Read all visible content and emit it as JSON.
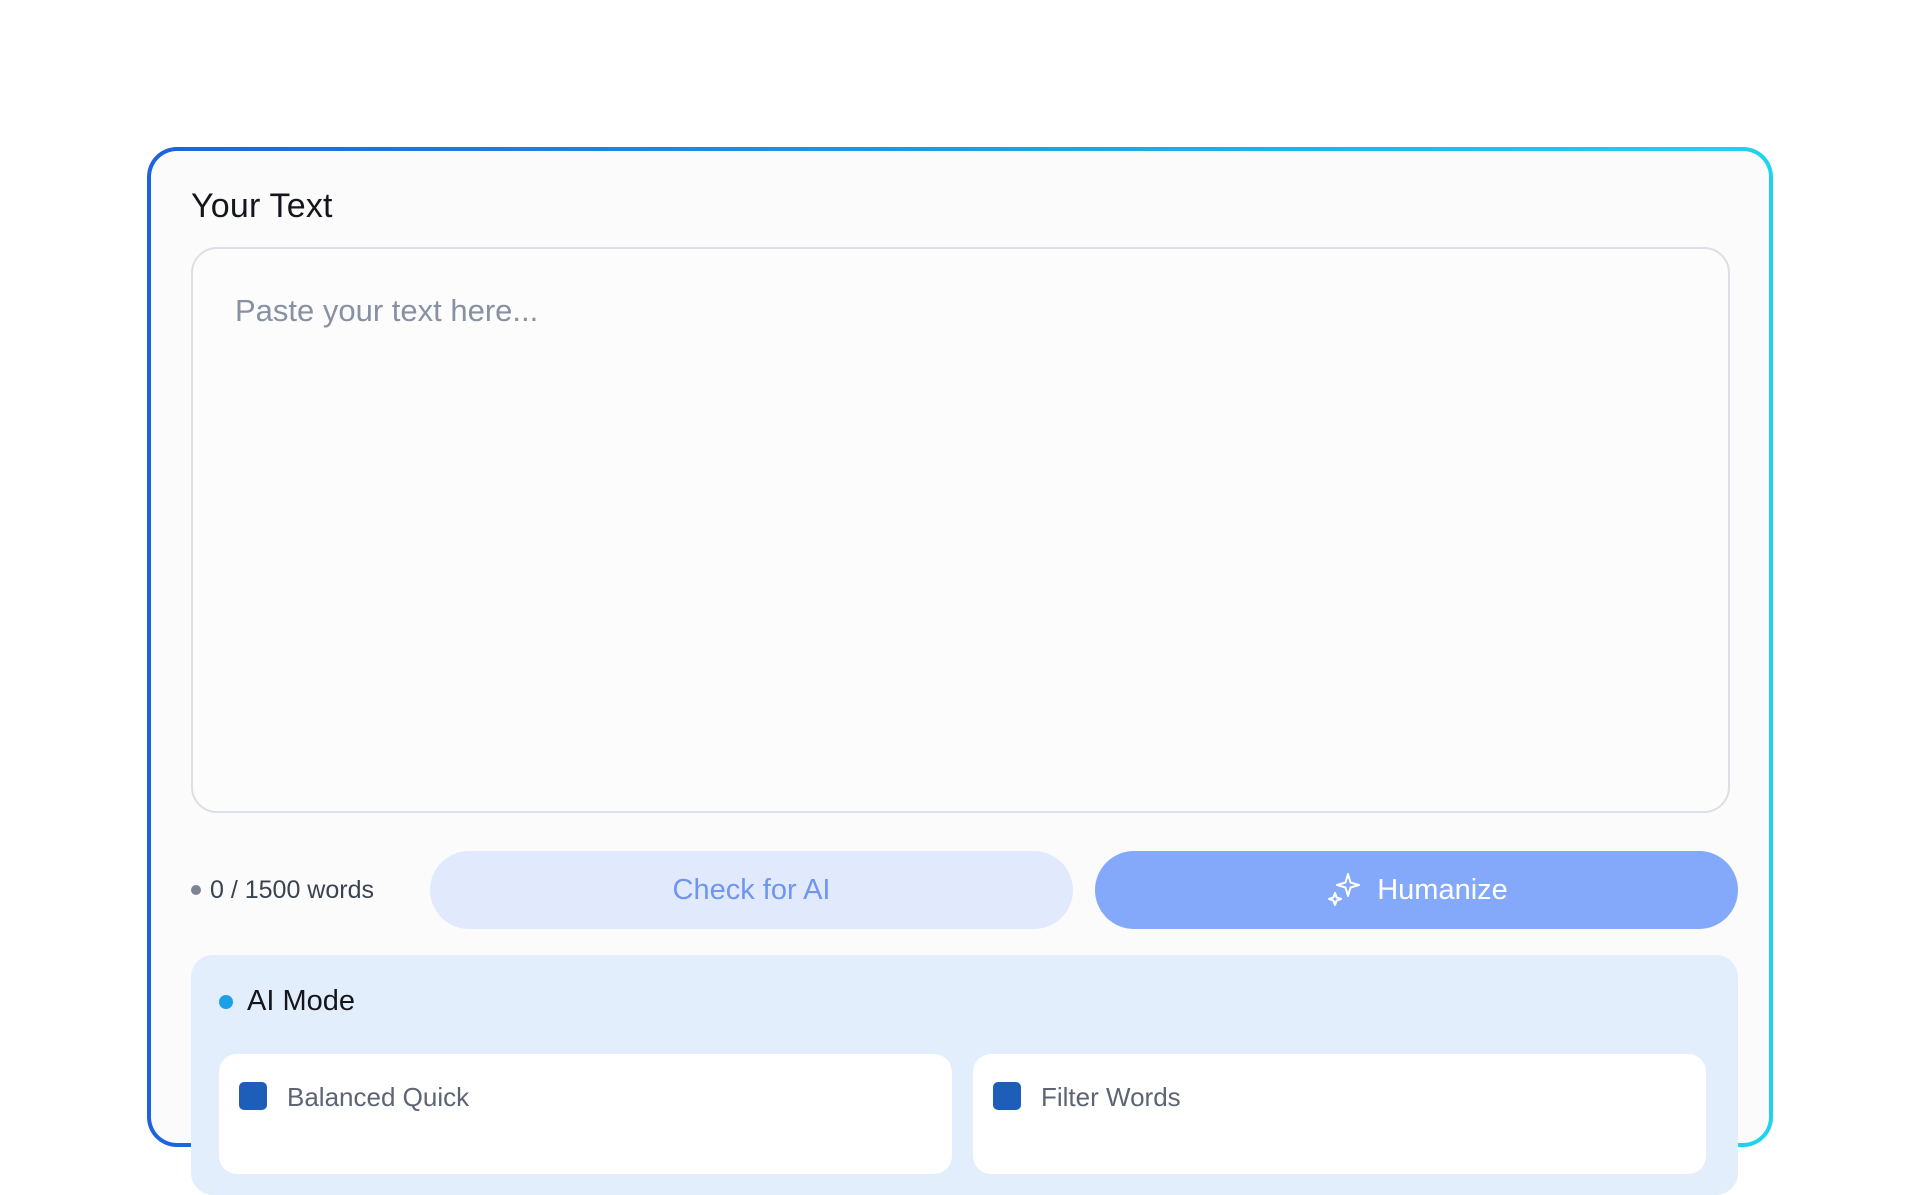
{
  "editor": {
    "title": "Your Text",
    "placeholder": "Paste your text here...",
    "value": ""
  },
  "controls": {
    "word_count": "0 / 1500 words",
    "check_label": "Check for AI",
    "humanize_label": "Humanize",
    "humanize_icon": "sparkles-icon"
  },
  "mode_panel": {
    "title": "AI Mode",
    "options": [
      {
        "label": "Balanced Quick",
        "checked": true
      },
      {
        "label": "Filter Words",
        "checked": true
      }
    ]
  },
  "colors": {
    "frame_gradient_start": "#1d63e0",
    "frame_gradient_end": "#1fd3ee",
    "primary_button": "#84a9fa",
    "secondary_button": "#e0eafc",
    "mode_panel_bg": "#e3eefd",
    "mode_dot": "#1aa0e6",
    "checkbox": "#1d5fb8"
  }
}
